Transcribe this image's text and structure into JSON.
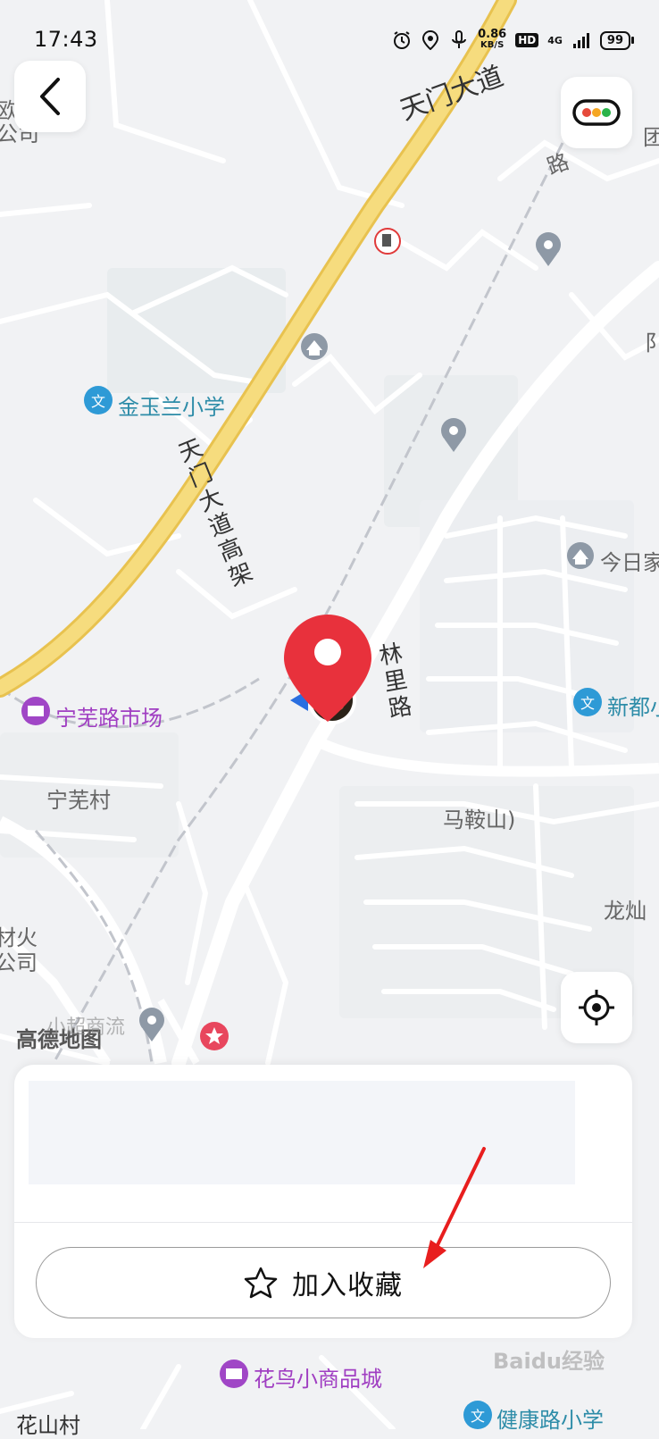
{
  "status_bar": {
    "time": "17:43",
    "speed_value": "0.86",
    "speed_unit": "KB/S",
    "hd": "HD",
    "network": "4G",
    "battery": "99",
    "icons": [
      "alarm-icon",
      "location-icon",
      "mic-icon",
      "signal-icon"
    ]
  },
  "map": {
    "labels": {
      "tianmen_road": "天门大道",
      "tianmen_elevated": "天门大道高架",
      "jinyulan_school": "金玉兰小学",
      "ningwu_market": "宁芜路市场",
      "ningwu_village": "宁芜村",
      "linli_road": "林里路",
      "maanshan": "马鞍山)",
      "maanshan_cut": "马鞍",
      "jinrijia": "今日家",
      "xindu": "新都小",
      "longshan": "龙灿",
      "huaniao": "花鸟小商品城",
      "huashan_village": "花山村",
      "jiankang_school": "健康路小学",
      "amap_logo": "高德地图",
      "edge_left_1": "欧",
      "edge_left_2": "公司",
      "edge_left_3": "材火",
      "edge_left_4": "公司",
      "edge_right_1": "团",
      "edge_right_2": "路",
      "edge_right_3": "阝",
      "poi_fragment": "小超商流"
    },
    "colors": {
      "background": "#f1f2f4",
      "highway": "#f6dc7e",
      "highway_edge": "#e8c24f",
      "road": "#ffffff",
      "railway": "#c2c5cc",
      "pin": "#e8313c"
    }
  },
  "buttons": {
    "back_icon": "chevron-left-icon",
    "traffic_icon": "traffic-light-icon",
    "locate_icon": "locate-icon"
  },
  "panel": {
    "favorite_label": "加入收藏",
    "favorite_icon": "star-outline-icon"
  },
  "watermark": "Baidu经验"
}
